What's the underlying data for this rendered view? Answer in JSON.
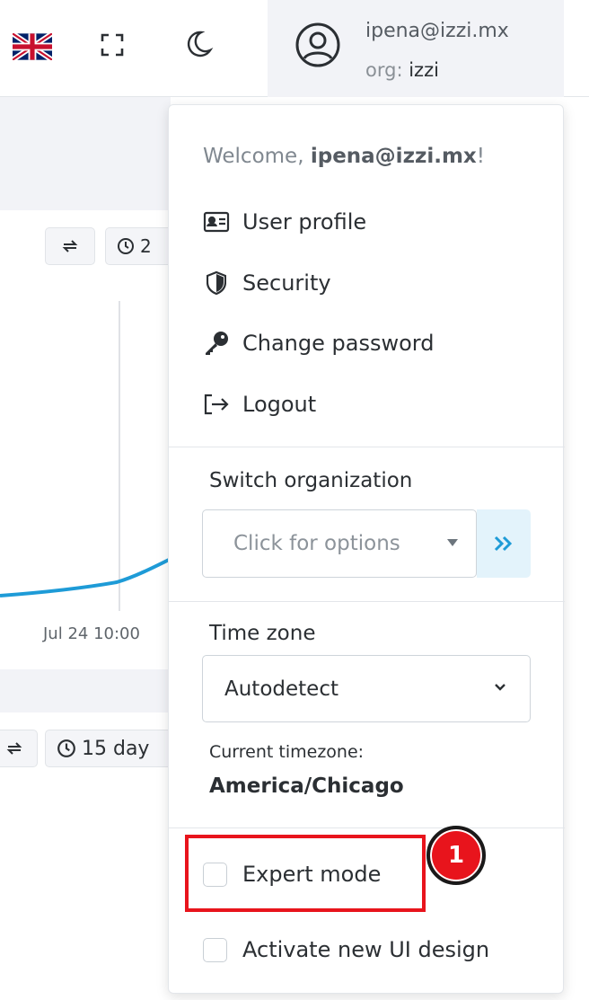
{
  "topbar": {
    "language_icon": "uk-flag-icon",
    "fullscreen_icon": "fullscreen-icon",
    "theme_icon": "moon-icon",
    "user": {
      "avatar_icon": "user-circle-icon",
      "email": "ipena@izzi.mx",
      "org_label": "org:",
      "org_value": "izzi"
    }
  },
  "background": {
    "panel1": {
      "time_range_partial": "2"
    },
    "chart": {
      "x_tick": "Jul 24 10:00",
      "line_color": "#1e9bd7"
    },
    "panel2": {
      "time_range_partial": "15 day"
    }
  },
  "menu": {
    "welcome_prefix": "Welcome, ",
    "welcome_user": "ipena@izzi.mx",
    "welcome_suffix": "!",
    "items": [
      {
        "label": "User profile",
        "icon": "id-card-icon"
      },
      {
        "label": "Security",
        "icon": "shield-icon"
      },
      {
        "label": "Change password",
        "icon": "key-icon"
      },
      {
        "label": "Logout",
        "icon": "logout-icon"
      }
    ],
    "switch_org": {
      "label": "Switch organization",
      "placeholder": "Click for options",
      "go_icon": "double-chevron-right-icon"
    },
    "timezone": {
      "label": "Time zone",
      "selected": "Autodetect",
      "current_label": "Current timezone:",
      "current_value": "America/Chicago"
    },
    "expert_mode": {
      "label": "Expert mode",
      "checked": false
    },
    "new_ui": {
      "label": "Activate new UI design",
      "checked": false
    }
  },
  "annotation": {
    "badge_number": "1",
    "color": "#e8141c"
  }
}
